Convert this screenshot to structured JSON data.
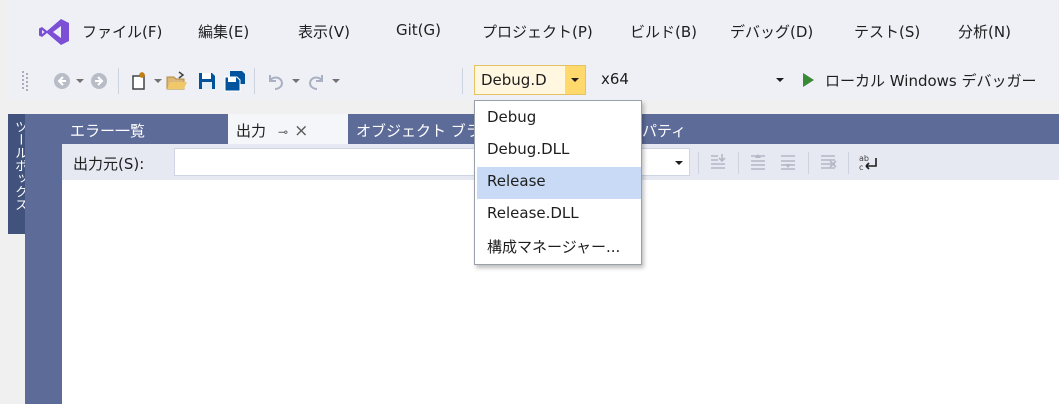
{
  "menu": {
    "items": [
      "ファイル(F)",
      "編集(E)",
      "表示(V)",
      "Git(G)",
      "プロジェクト(P)",
      "ビルド(B)",
      "デバッグ(D)",
      "テスト(S)",
      "分析(N)"
    ]
  },
  "toolbar": {
    "configuration": "Debug.D",
    "platform": "x64",
    "debugger": "ローカル Windows デバッガー"
  },
  "toolbox": {
    "label": "ツールボックス"
  },
  "tabs": {
    "errors": "エラー一覧",
    "output": "出力",
    "object_browser": "オブジェクト ブラ",
    "properties": "パティ"
  },
  "output": {
    "source_label": "出力元(S):"
  },
  "dropdown": {
    "items": [
      "Debug",
      "Debug.DLL",
      "Release",
      "Release.DLL",
      "構成マネージャー..."
    ],
    "selected": "Release"
  },
  "colors": {
    "vs_purple": "#7b4fd6",
    "tab_strip": "#5d6b99",
    "selection": "#c9daf6",
    "combo_highlight": "#ffd96b"
  }
}
